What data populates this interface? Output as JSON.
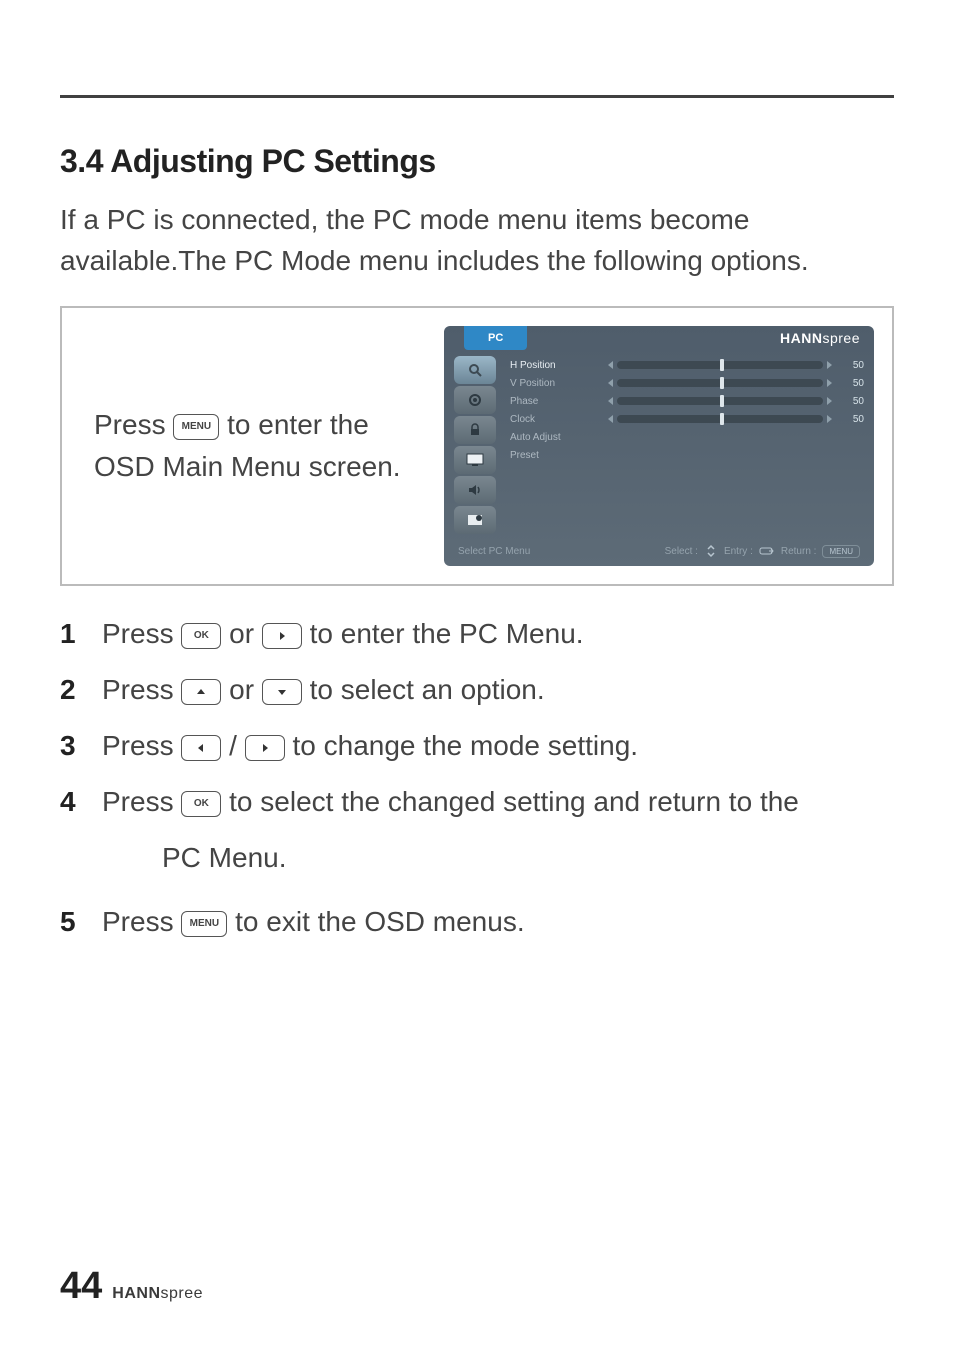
{
  "section": {
    "title": "3.4  Adjusting PC Settings",
    "intro": "If a PC is connected, the PC mode menu items become available.The PC Mode menu includes the following options."
  },
  "panel": {
    "press": "Press ",
    "rest": " to enter the OSD Main Menu screen.",
    "menu_btn": "MENU"
  },
  "osd": {
    "tab": "PC",
    "brand_bold": "HANN",
    "brand_rest": "spree",
    "rows": {
      "hpos": {
        "label": "H Position",
        "value": "50"
      },
      "vpos": {
        "label": "V Position",
        "value": "50"
      },
      "phase": {
        "label": "Phase",
        "value": "50"
      },
      "clock": {
        "label": "Clock",
        "value": "50"
      },
      "auto": {
        "label": "Auto Adjust"
      },
      "preset": {
        "label": "Preset"
      }
    },
    "footer": {
      "left": "Select PC Menu",
      "mid1": "Select :",
      "mid2": "Entry :",
      "right": "Return :",
      "right_btn": "MENU"
    }
  },
  "steps": {
    "s1a": "Press ",
    "s1_ok": "OK",
    "s1b": " or ",
    "s1c": " to enter the PC Menu.",
    "s2a": "Press ",
    "s2b": " or ",
    "s2c": " to select an option.",
    "s3a": "Press ",
    "s3b": " / ",
    "s3c": " to change the mode setting.",
    "s4a": "Press ",
    "s4_ok": "OK",
    "s4b": " to select the changed setting and return to the",
    "s4c": "PC Menu.",
    "s5a": "Press ",
    "s5_menu": "MENU",
    "s5b": " to exit the OSD menus."
  },
  "footer": {
    "page": "44",
    "brand_bold": "HANN",
    "brand_rest": "spree"
  }
}
